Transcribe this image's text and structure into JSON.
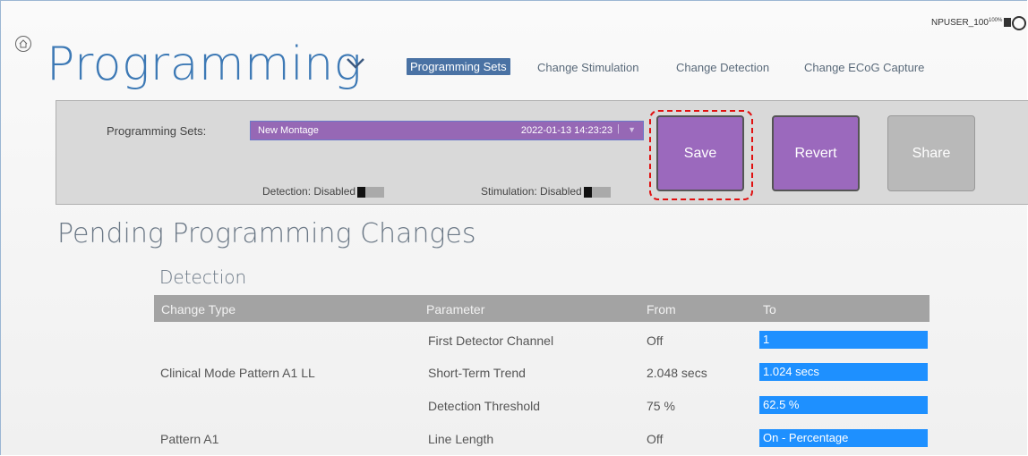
{
  "header": {
    "title": "Programming",
    "user": "NPUSER_100",
    "battery": "100%",
    "nav": [
      "Programming Sets",
      "Change Stimulation",
      "Change Detection",
      "Change ECoG Capture"
    ]
  },
  "panel": {
    "ps_label": "Programming Sets:",
    "select_name": "New Montage",
    "select_date": "2022-01-13 14:23:23",
    "detection_status": "Detection: Disabled",
    "stimulation_status": "Stimulation: Disabled",
    "buttons": {
      "save": "Save",
      "revert": "Revert",
      "share": "Share"
    }
  },
  "pending": {
    "heading": "Pending Programming Changes",
    "section": "Detection",
    "columns": [
      "Change Type",
      "Parameter",
      "From",
      "To"
    ],
    "rows": [
      {
        "change_type": "",
        "parameter": "First Detector Channel",
        "from": "Off",
        "to": "1"
      },
      {
        "change_type": "Clinical Mode Pattern A1 LL",
        "parameter": "Short-Term Trend",
        "from": "2.048 secs",
        "to": "1.024 secs"
      },
      {
        "change_type": "",
        "parameter": "Detection Threshold",
        "from": "75 %",
        "to": "62.5 %"
      },
      {
        "change_type": "Pattern A1",
        "parameter": "Line Length",
        "from": "Off",
        "to": "On - Percentage"
      }
    ]
  },
  "colors": {
    "accent": "#3d79b5",
    "button": "#9b69bd",
    "highlight": "#e01010",
    "to_cell": "#1e90ff"
  }
}
